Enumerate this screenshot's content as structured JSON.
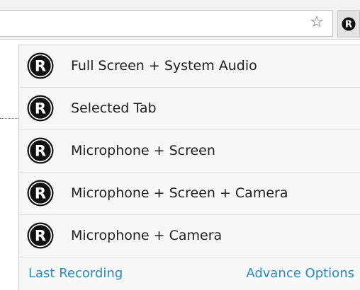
{
  "toolbar": {
    "star_icon": "☆",
    "extension_icon": "R"
  },
  "menu": {
    "items": [
      {
        "label": "Full Screen + System Audio",
        "icon": "recorder-logo-icon"
      },
      {
        "label": "Selected Tab",
        "icon": "recorder-logo-icon"
      },
      {
        "label": "Microphone + Screen",
        "icon": "recorder-logo-icon"
      },
      {
        "label": "Microphone + Screen + Camera",
        "icon": "recorder-logo-icon"
      },
      {
        "label": "Microphone + Camera",
        "icon": "recorder-logo-icon"
      }
    ],
    "logo_letter": "R"
  },
  "footer": {
    "last_recording": "Last Recording",
    "advance_options": "Advance Options"
  },
  "colors": {
    "link": "#2a8ab8",
    "logo_bg": "#111111",
    "logo_fg": "#ffffff",
    "popup_bg": "#f7f7f7"
  }
}
